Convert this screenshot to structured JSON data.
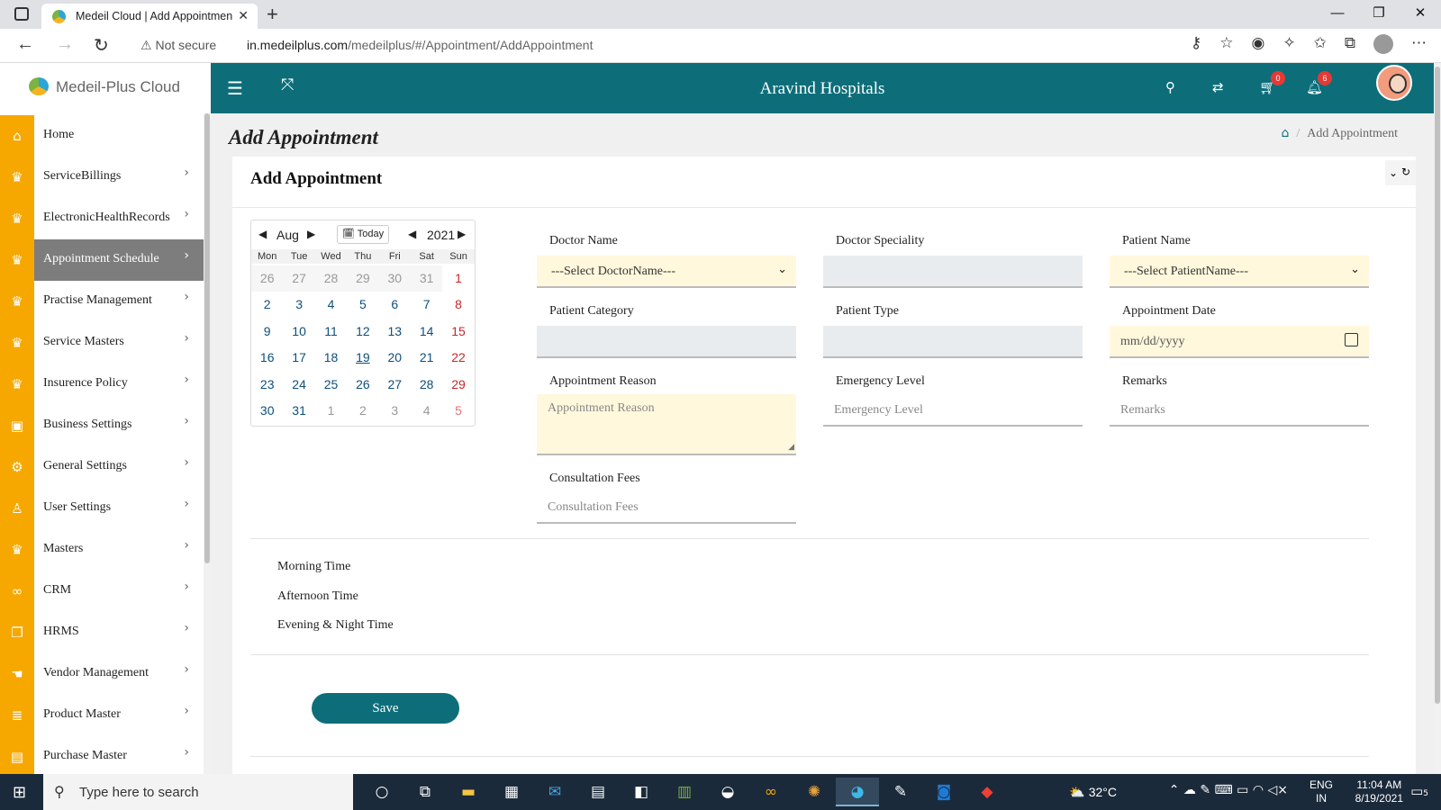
{
  "browser": {
    "tab_title": "Medeil Cloud | Add Appointmen",
    "security_label": "Not secure",
    "url_host": "in.medeilplus.com",
    "url_path": "/medeilplus/#/Appointment/AddAppointment"
  },
  "sidebar": {
    "brand": "Medeil-Plus Cloud",
    "items": [
      {
        "label": "Home",
        "icon": "home-icon",
        "glyph": "⌂",
        "chevron": false,
        "active": false
      },
      {
        "label": "ServiceBillings",
        "icon": "crown-icon",
        "glyph": "♛",
        "chevron": true,
        "active": false
      },
      {
        "label": "ElectronicHealthRecords",
        "icon": "crown-icon",
        "glyph": "♛",
        "chevron": true,
        "active": false
      },
      {
        "label": "Appointment Schedule",
        "icon": "crown-icon",
        "glyph": "♛",
        "chevron": true,
        "active": true
      },
      {
        "label": "Practise Management",
        "icon": "crown-icon",
        "glyph": "♛",
        "chevron": true,
        "active": false
      },
      {
        "label": "Service Masters",
        "icon": "crown-icon",
        "glyph": "♛",
        "chevron": true,
        "active": false
      },
      {
        "label": "Insurence Policy",
        "icon": "crown-icon",
        "glyph": "♛",
        "chevron": true,
        "active": false
      },
      {
        "label": "Business Settings",
        "icon": "save-icon",
        "glyph": "▣",
        "chevron": true,
        "active": false
      },
      {
        "label": "General Settings",
        "icon": "gear-icon",
        "glyph": "⚙",
        "chevron": true,
        "active": false
      },
      {
        "label": "User Settings",
        "icon": "user-icon",
        "glyph": "♙",
        "chevron": true,
        "active": false
      },
      {
        "label": "Masters",
        "icon": "crown-icon",
        "glyph": "♛",
        "chevron": true,
        "active": false
      },
      {
        "label": "CRM",
        "icon": "link-icon",
        "glyph": "∞",
        "chevron": true,
        "active": false
      },
      {
        "label": "HRMS",
        "icon": "copy-icon",
        "glyph": "❐",
        "chevron": true,
        "active": false
      },
      {
        "label": "Vendor Management",
        "icon": "hand-icon",
        "glyph": "☚",
        "chevron": true,
        "active": false
      },
      {
        "label": "Product Master",
        "icon": "database-icon",
        "glyph": "≣",
        "chevron": true,
        "active": false
      },
      {
        "label": "Purchase Master",
        "icon": "book-icon",
        "glyph": "▤",
        "chevron": true,
        "active": false
      }
    ]
  },
  "header": {
    "hospital": "Aravind Hospitals",
    "cart_count": "0",
    "notification_count": "6"
  },
  "page": {
    "title": "Add Appointment",
    "breadcrumb": "Add Appointment",
    "card_title": "Add Appointment"
  },
  "calendar": {
    "month": "Aug",
    "year": "2021",
    "today_label": "Today",
    "weekdays": [
      "Mon",
      "Tue",
      "Wed",
      "Thu",
      "Fri",
      "Sat",
      "Sun"
    ],
    "days": [
      {
        "d": "26",
        "other": true,
        "weekend": false
      },
      {
        "d": "27",
        "other": true,
        "weekend": false
      },
      {
        "d": "28",
        "other": true,
        "weekend": false
      },
      {
        "d": "29",
        "other": true,
        "weekend": false
      },
      {
        "d": "30",
        "other": true,
        "weekend": false
      },
      {
        "d": "31",
        "other": true,
        "weekend": false
      },
      {
        "d": "1",
        "other": false,
        "weekend": true
      },
      {
        "d": "2",
        "other": false,
        "weekend": false
      },
      {
        "d": "3",
        "other": false,
        "weekend": false
      },
      {
        "d": "4",
        "other": false,
        "weekend": false
      },
      {
        "d": "5",
        "other": false,
        "weekend": false
      },
      {
        "d": "6",
        "other": false,
        "weekend": false
      },
      {
        "d": "7",
        "other": false,
        "weekend": false
      },
      {
        "d": "8",
        "other": false,
        "weekend": true
      },
      {
        "d": "9",
        "other": false,
        "weekend": false
      },
      {
        "d": "10",
        "other": false,
        "weekend": false
      },
      {
        "d": "11",
        "other": false,
        "weekend": false
      },
      {
        "d": "12",
        "other": false,
        "weekend": false
      },
      {
        "d": "13",
        "other": false,
        "weekend": false
      },
      {
        "d": "14",
        "other": false,
        "weekend": false
      },
      {
        "d": "15",
        "other": false,
        "weekend": true
      },
      {
        "d": "16",
        "other": false,
        "weekend": false
      },
      {
        "d": "17",
        "other": false,
        "weekend": false
      },
      {
        "d": "18",
        "other": false,
        "weekend": false
      },
      {
        "d": "19",
        "other": false,
        "weekend": false,
        "today": true
      },
      {
        "d": "20",
        "other": false,
        "weekend": false
      },
      {
        "d": "21",
        "other": false,
        "weekend": false
      },
      {
        "d": "22",
        "other": false,
        "weekend": true
      },
      {
        "d": "23",
        "other": false,
        "weekend": false
      },
      {
        "d": "24",
        "other": false,
        "weekend": false
      },
      {
        "d": "25",
        "other": false,
        "weekend": false
      },
      {
        "d": "26",
        "other": false,
        "weekend": false
      },
      {
        "d": "27",
        "other": false,
        "weekend": false
      },
      {
        "d": "28",
        "other": false,
        "weekend": false
      },
      {
        "d": "29",
        "other": false,
        "weekend": true
      },
      {
        "d": "30",
        "other": false,
        "weekend": false
      },
      {
        "d": "31",
        "other": false,
        "weekend": false
      },
      {
        "d": "1",
        "other": true,
        "weekend": false
      },
      {
        "d": "2",
        "other": true,
        "weekend": false
      },
      {
        "d": "3",
        "other": true,
        "weekend": false
      },
      {
        "d": "4",
        "other": true,
        "weekend": false
      },
      {
        "d": "5",
        "other": true,
        "weekend": true
      }
    ]
  },
  "form": {
    "doctor_name_label": "Doctor Name",
    "doctor_name_value": "---Select DoctorName---",
    "doctor_speciality_label": "Doctor Speciality",
    "patient_name_label": "Patient Name",
    "patient_name_value": "---Select PatientName---",
    "patient_category_label": "Patient Category",
    "patient_type_label": "Patient Type",
    "appointment_date_label": "Appointment Date",
    "appointment_date_placeholder": "mm/dd/yyyy",
    "appointment_reason_label": "Appointment Reason",
    "appointment_reason_placeholder": "Appointment Reason",
    "emergency_level_label": "Emergency Level",
    "emergency_level_placeholder": "Emergency Level",
    "remarks_label": "Remarks",
    "remarks_placeholder": "Remarks",
    "consultation_fees_label": "Consultation Fees",
    "consultation_fees_placeholder": "Consultation Fees"
  },
  "times": {
    "morning": "Morning Time",
    "afternoon": "Afternoon Time",
    "evening": "Evening & Night Time"
  },
  "actions": {
    "save": "Save"
  },
  "taskbar": {
    "search_placeholder": "Type here to search",
    "temperature": "32°C",
    "lang_1": "ENG",
    "lang_2": "IN",
    "time": "11:04 AM",
    "date": "8/19/2021",
    "notification_count": "5"
  },
  "colors": {
    "teal": "#0d6e7a",
    "accent": "#f6a800",
    "active_menu": "#7d7d7d",
    "field_yellow": "#fff8dc"
  }
}
